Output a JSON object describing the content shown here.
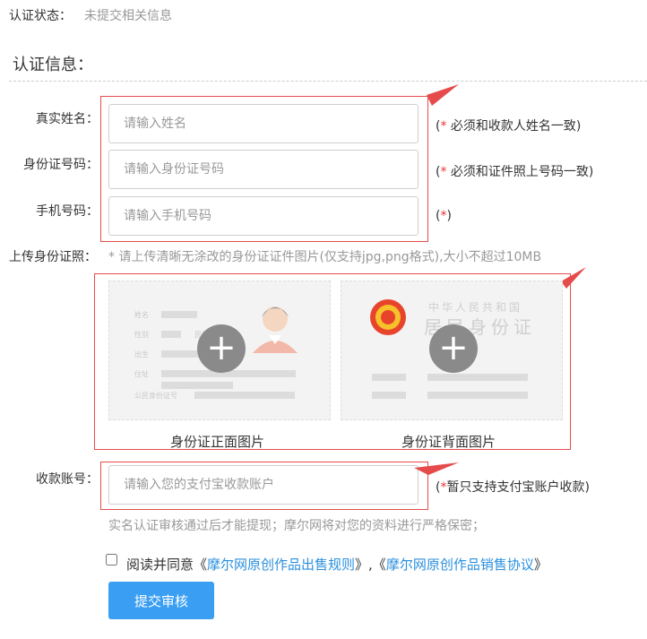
{
  "status": {
    "label": "认证状态：",
    "value": "未提交相关信息"
  },
  "section_title": "认证信息：",
  "fields": {
    "name": {
      "label": "真实姓名：",
      "placeholder": "请输入姓名",
      "note_star": "*",
      "note_text": " 必须和收款人姓名一致)"
    },
    "id": {
      "label": "身份证号码：",
      "placeholder": "请输入身份证号码",
      "note_star": "*",
      "note_text": " 必须和证件照上号码一致)"
    },
    "phone": {
      "label": "手机号码：",
      "placeholder": "请输入手机号码",
      "note_star": "*",
      "note_text": ")"
    }
  },
  "upload": {
    "label": "上传身份证照：",
    "hint": "* 请上传清晰无涂改的身份证证件图片(仅支持jpg,png格式),大小不超过10MB",
    "front_caption": "身份证正面图片",
    "back_caption": "身份证背面图片",
    "front_card": {
      "name": "姓名",
      "gender": "性别",
      "ethnicity": "民族",
      "birth": "出生",
      "address": "住址",
      "id_number": "公民身份证号"
    },
    "back_card": {
      "country": "中华人民共和国",
      "title": "居民身份证"
    }
  },
  "account": {
    "label": "收款账号：",
    "placeholder": "请输入您的支付宝收款账户",
    "note_star": "*",
    "note_text": "暂只支持支付宝账户收款)"
  },
  "notice": "实名认证审核通过后才能提现；摩尔网将对您的资料进行严格保密；",
  "agreement": {
    "prefix": "阅读并同意《",
    "link1": "摩尔网原创作品出售规则",
    "middle": "》,《",
    "link2": "摩尔网原创作品销售协议",
    "suffix": "》"
  },
  "submit_label": "提交审核",
  "colors": {
    "accent": "#3a9ff3",
    "highlight_red": "#e64b4b",
    "link": "#2a8fde"
  }
}
